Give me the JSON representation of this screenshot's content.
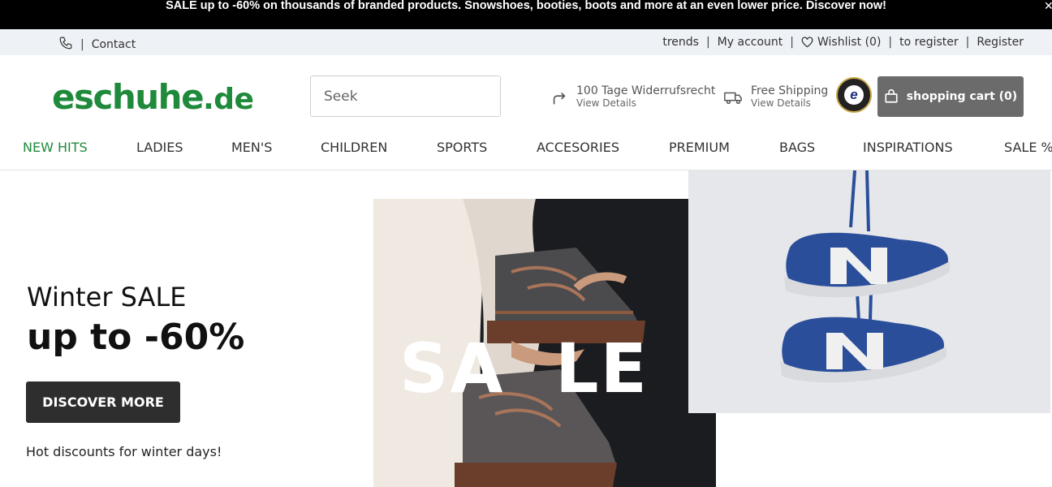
{
  "promo": {
    "text": "SALE up to -60% on thousands of branded products. Snowshoes, booties, boots and more at an even lower price. Discover now!"
  },
  "utility": {
    "contact": "Contact",
    "links": [
      "trends",
      "My account",
      "Wishlist (0)",
      "to register",
      "Register"
    ]
  },
  "header": {
    "logo_main": "eschuhe",
    "logo_tld": ".de",
    "search_placeholder": "Seek",
    "perks": [
      {
        "title": "100 Tage Widerrufsrecht",
        "sub": "View Details",
        "icon": "return-arrow-icon"
      },
      {
        "title": "Free Shipping",
        "sub": "View Details",
        "icon": "truck-icon"
      }
    ],
    "badge_letter": "e",
    "cart_label": "shopping cart (0)"
  },
  "nav": {
    "items": [
      "NEW HITS",
      "LADIES",
      "MEN'S",
      "CHILDREN",
      "SPORTS",
      "ACCESORIES",
      "PREMIUM",
      "BAGS",
      "INSPIRATIONS",
      "SALE %"
    ]
  },
  "hero": {
    "line1": "Winter SALE",
    "line2": "up to -60%",
    "button": "DISCOVER MORE",
    "sub": "Hot discounts for winter days!",
    "image_word": "SA  LE"
  },
  "colors": {
    "brand_green": "#1f8a3b",
    "promo_bg": "#000000",
    "util_bg": "#eef1f5",
    "cart_bg": "#6b6b6b",
    "button_bg": "#2e2e2e"
  }
}
